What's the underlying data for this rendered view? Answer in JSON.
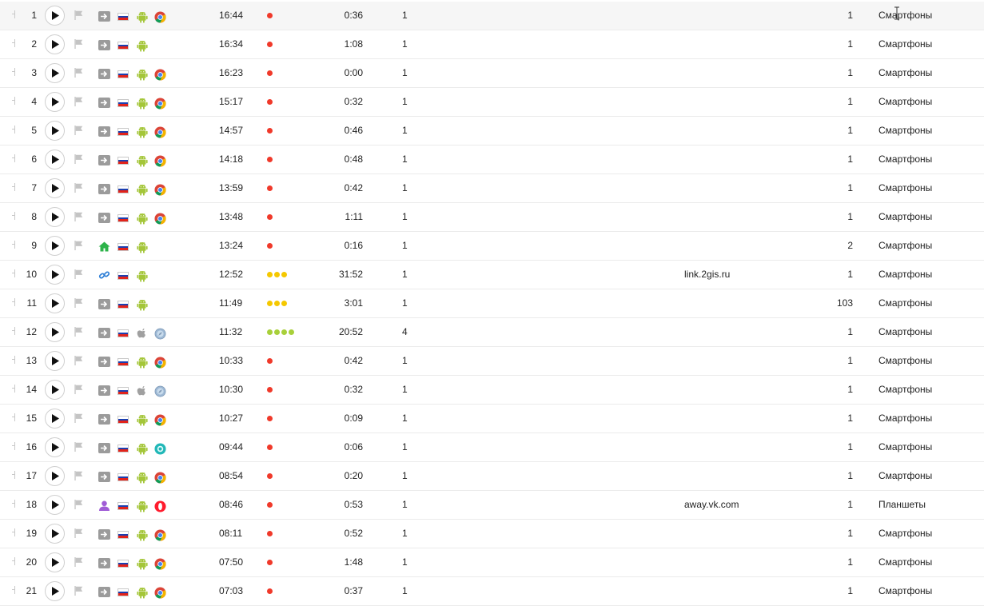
{
  "colors": {
    "red_dot": "#f0392a",
    "yellow_dot": "#f5c800",
    "green_dot": "#a8d03a",
    "android_green": "#a4c639",
    "home_green": "#2db34a",
    "link_blue": "#2f7fd6",
    "profile_purple": "#a05bd6"
  },
  "rows": [
    {
      "num": "1",
      "src": "direct-icon",
      "os": "android-icon",
      "br": "chrome-icon",
      "time": "16:44",
      "dots": "red",
      "dot_count": 1,
      "duration": "0:36",
      "pages": "1",
      "referrer": "",
      "visits": "1",
      "device": "Смартфоны"
    },
    {
      "num": "2",
      "src": "direct-icon",
      "os": "android-icon",
      "br": "",
      "time": "16:34",
      "dots": "red",
      "dot_count": 1,
      "duration": "1:08",
      "pages": "1",
      "referrer": "",
      "visits": "1",
      "device": "Смартфоны"
    },
    {
      "num": "3",
      "src": "direct-icon",
      "os": "android-icon",
      "br": "chrome-icon",
      "time": "16:23",
      "dots": "red",
      "dot_count": 1,
      "duration": "0:00",
      "pages": "1",
      "referrer": "",
      "visits": "1",
      "device": "Смартфоны"
    },
    {
      "num": "4",
      "src": "direct-icon",
      "os": "android-icon",
      "br": "chrome-icon",
      "time": "15:17",
      "dots": "red",
      "dot_count": 1,
      "duration": "0:32",
      "pages": "1",
      "referrer": "",
      "visits": "1",
      "device": "Смартфоны"
    },
    {
      "num": "5",
      "src": "direct-icon",
      "os": "android-icon",
      "br": "chrome-icon",
      "time": "14:57",
      "dots": "red",
      "dot_count": 1,
      "duration": "0:46",
      "pages": "1",
      "referrer": "",
      "visits": "1",
      "device": "Смартфоны"
    },
    {
      "num": "6",
      "src": "direct-icon",
      "os": "android-icon",
      "br": "chrome-icon",
      "time": "14:18",
      "dots": "red",
      "dot_count": 1,
      "duration": "0:48",
      "pages": "1",
      "referrer": "",
      "visits": "1",
      "device": "Смартфоны"
    },
    {
      "num": "7",
      "src": "direct-icon",
      "os": "android-icon",
      "br": "chrome-icon",
      "time": "13:59",
      "dots": "red",
      "dot_count": 1,
      "duration": "0:42",
      "pages": "1",
      "referrer": "",
      "visits": "1",
      "device": "Смартфоны"
    },
    {
      "num": "8",
      "src": "direct-icon",
      "os": "android-icon",
      "br": "chrome-icon",
      "time": "13:48",
      "dots": "red",
      "dot_count": 1,
      "duration": "1:11",
      "pages": "1",
      "referrer": "",
      "visits": "1",
      "device": "Смартфоны"
    },
    {
      "num": "9",
      "src": "home-icon",
      "os": "android-icon",
      "br": "",
      "time": "13:24",
      "dots": "red",
      "dot_count": 1,
      "duration": "0:16",
      "pages": "1",
      "referrer": "",
      "visits": "2",
      "device": "Смартфоны"
    },
    {
      "num": "10",
      "src": "link-icon",
      "os": "android-icon",
      "br": "",
      "time": "12:52",
      "dots": "yellow",
      "dot_count": 3,
      "duration": "31:52",
      "pages": "1",
      "referrer": "link.2gis.ru",
      "visits": "1",
      "device": "Смартфоны"
    },
    {
      "num": "11",
      "src": "direct-icon",
      "os": "android-icon",
      "br": "",
      "time": "11:49",
      "dots": "yellow",
      "dot_count": 3,
      "duration": "3:01",
      "pages": "1",
      "referrer": "",
      "visits": "103",
      "device": "Смартфоны"
    },
    {
      "num": "12",
      "src": "direct-icon",
      "os": "apple-icon",
      "br": "safari-icon",
      "time": "11:32",
      "dots": "green",
      "dot_count": 4,
      "duration": "20:52",
      "pages": "4",
      "referrer": "",
      "visits": "1",
      "device": "Смартфоны"
    },
    {
      "num": "13",
      "src": "direct-icon",
      "os": "android-icon",
      "br": "chrome-icon",
      "time": "10:33",
      "dots": "red",
      "dot_count": 1,
      "duration": "0:42",
      "pages": "1",
      "referrer": "",
      "visits": "1",
      "device": "Смартфоны"
    },
    {
      "num": "14",
      "src": "direct-icon",
      "os": "apple-icon",
      "br": "safari-icon",
      "time": "10:30",
      "dots": "red",
      "dot_count": 1,
      "duration": "0:32",
      "pages": "1",
      "referrer": "",
      "visits": "1",
      "device": "Смартфоны"
    },
    {
      "num": "15",
      "src": "direct-icon",
      "os": "android-icon",
      "br": "chrome-icon",
      "time": "10:27",
      "dots": "red",
      "dot_count": 1,
      "duration": "0:09",
      "pages": "1",
      "referrer": "",
      "visits": "1",
      "device": "Смартфоны"
    },
    {
      "num": "16",
      "src": "direct-icon",
      "os": "android-icon",
      "br": "yabrowser-icon",
      "time": "09:44",
      "dots": "red",
      "dot_count": 1,
      "duration": "0:06",
      "pages": "1",
      "referrer": "",
      "visits": "1",
      "device": "Смартфоны"
    },
    {
      "num": "17",
      "src": "direct-icon",
      "os": "android-icon",
      "br": "chrome-icon",
      "time": "08:54",
      "dots": "red",
      "dot_count": 1,
      "duration": "0:20",
      "pages": "1",
      "referrer": "",
      "visits": "1",
      "device": "Смартфоны"
    },
    {
      "num": "18",
      "src": "social-icon",
      "os": "android-icon",
      "br": "opera-icon",
      "time": "08:46",
      "dots": "red",
      "dot_count": 1,
      "duration": "0:53",
      "pages": "1",
      "referrer": "away.vk.com",
      "visits": "1",
      "device": "Планшеты"
    },
    {
      "num": "19",
      "src": "direct-icon",
      "os": "android-icon",
      "br": "chrome-icon",
      "time": "08:11",
      "dots": "red",
      "dot_count": 1,
      "duration": "0:52",
      "pages": "1",
      "referrer": "",
      "visits": "1",
      "device": "Смартфоны"
    },
    {
      "num": "20",
      "src": "direct-icon",
      "os": "android-icon",
      "br": "chrome-icon",
      "time": "07:50",
      "dots": "red",
      "dot_count": 1,
      "duration": "1:48",
      "pages": "1",
      "referrer": "",
      "visits": "1",
      "device": "Смартфоны"
    },
    {
      "num": "21",
      "src": "direct-icon",
      "os": "android-icon",
      "br": "chrome-icon",
      "time": "07:03",
      "dots": "red",
      "dot_count": 1,
      "duration": "0:37",
      "pages": "1",
      "referrer": "",
      "visits": "1",
      "device": "Смартфоны"
    }
  ]
}
